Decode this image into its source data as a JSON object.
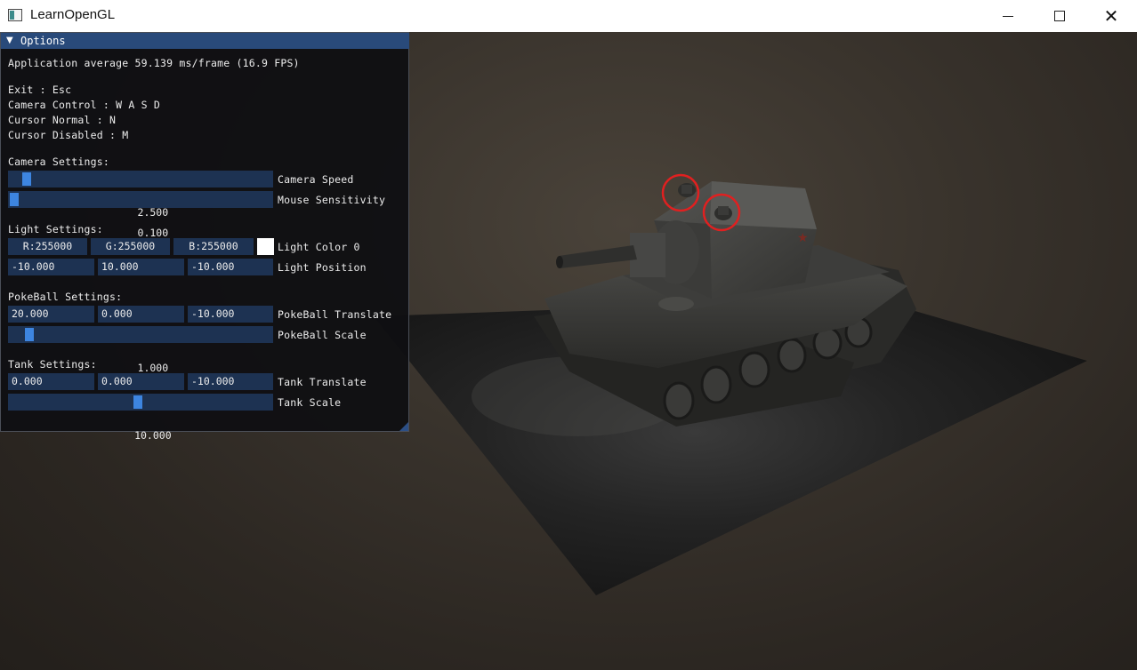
{
  "window": {
    "title": "LearnOpenGL",
    "controls": [
      "minimize",
      "maximize",
      "close"
    ]
  },
  "panel": {
    "title": "Options",
    "fps_line": "Application average 59.139 ms/frame (16.9 FPS)",
    "help": {
      "exit": "Exit : Esc",
      "camera_control": "Camera Control : W A S D",
      "cursor_normal": "Cursor Normal : N",
      "cursor_disabled": "Cursor Disabled : M"
    },
    "camera": {
      "header": "Camera Settings:",
      "speed": {
        "value": "2.500",
        "label": "Camera Speed",
        "level": 0.05
      },
      "sensitivity": {
        "value": "0.100",
        "label": "Mouse Sensitivity",
        "level": 0.0
      }
    },
    "light": {
      "header": "Light Settings:",
      "color": {
        "r": "R:255000",
        "g": "G:255000",
        "b": "B:255000",
        "label": "Light Color 0",
        "swatch": "#ffffff"
      },
      "position": {
        "x": "-10.000",
        "y": "10.000",
        "z": "-10.000",
        "label": "Light Position"
      }
    },
    "pokeball": {
      "header": "PokeBall Settings:",
      "translate": {
        "x": "20.000",
        "y": "0.000",
        "z": "-10.000",
        "label": "PokeBall Translate"
      },
      "scale": {
        "value": "1.000",
        "label": "PokeBall Scale",
        "level": 0.06
      }
    },
    "tank": {
      "header": "Tank Settings:",
      "translate": {
        "x": "0.000",
        "y": "0.000",
        "z": "-10.000",
        "label": "Tank Translate"
      },
      "scale": {
        "value": "10.000",
        "label": "Tank Scale",
        "level": 0.49
      }
    }
  },
  "colors": {
    "title_bar": "#294a7a",
    "frame_bg": "#1d3252",
    "slider_grab": "#3d85e0",
    "highlight_circle": "#e02020"
  },
  "scene": {
    "model": "tank",
    "annotations": [
      "red-circle-hatch-left",
      "red-circle-hatch-right"
    ]
  }
}
